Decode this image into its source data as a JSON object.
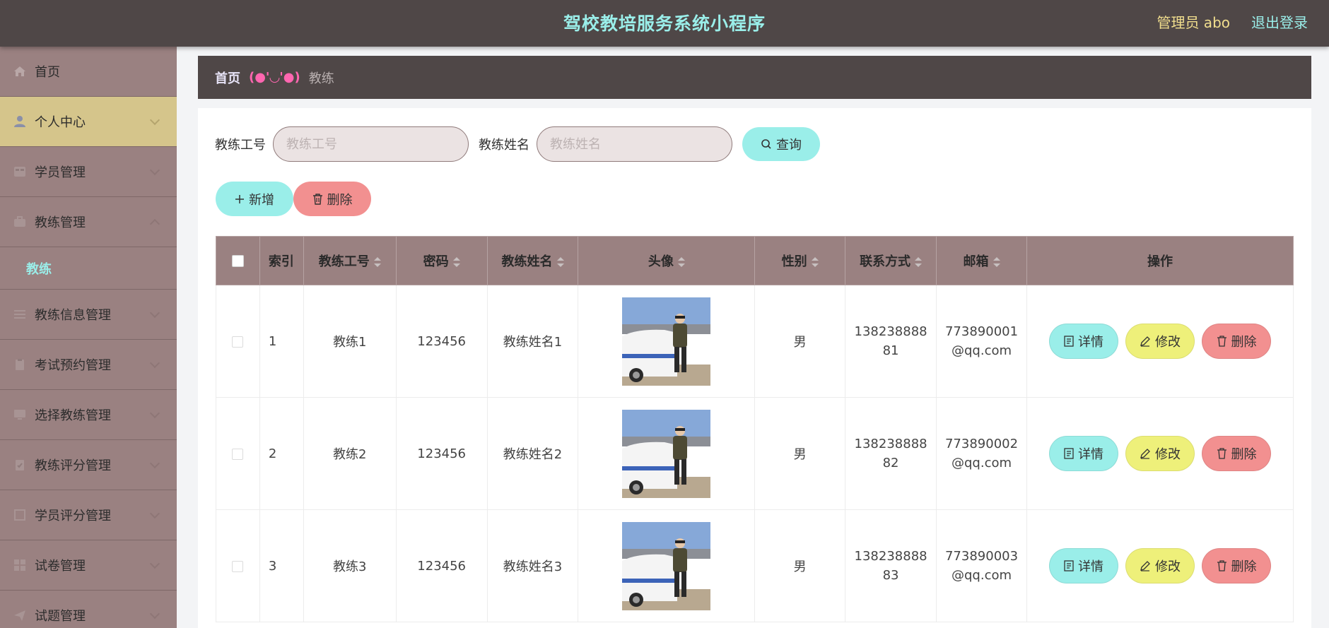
{
  "header": {
    "title": "驾校教培服务系统小程序",
    "admin": "管理员 abo",
    "logout": "退出登录"
  },
  "sidebar": {
    "items": [
      {
        "label": "首页",
        "icon": "home-icon"
      },
      {
        "label": "个人中心",
        "icon": "user-icon"
      },
      {
        "label": "学员管理",
        "icon": "grid-icon"
      },
      {
        "label": "教练管理",
        "icon": "briefcase-icon"
      },
      {
        "label": "教练",
        "icon": ""
      },
      {
        "label": "教练信息管理",
        "icon": "list-icon"
      },
      {
        "label": "考试预约管理",
        "icon": "clipboard-icon"
      },
      {
        "label": "选择教练管理",
        "icon": "monitor-icon"
      },
      {
        "label": "教练评分管理",
        "icon": "clipboard-check-icon"
      },
      {
        "label": "学员评分管理",
        "icon": "square-icon"
      },
      {
        "label": "试卷管理",
        "icon": "apps-icon"
      },
      {
        "label": "试题管理",
        "icon": "send-icon"
      }
    ]
  },
  "breadcrumb": {
    "home": "首页",
    "separator": "(●'◡'●)",
    "current": "教练"
  },
  "search": {
    "id_label": "教练工号",
    "id_placeholder": "教练工号",
    "name_label": "教练姓名",
    "name_placeholder": "教练姓名",
    "query_label": "查询"
  },
  "actions": {
    "add_label": "新增",
    "delete_label": "删除"
  },
  "table": {
    "headers": [
      "索引",
      "教练工号",
      "密码",
      "教练姓名",
      "头像",
      "性别",
      "联系方式",
      "邮箱",
      "操作"
    ],
    "rows": [
      {
        "index": "1",
        "coach_id": "教练1",
        "password": "123456",
        "name": "教练姓名1",
        "gender": "男",
        "phone_a": "138238888",
        "phone_b": "81",
        "email_a": "773890001",
        "email_b": "@qq.com"
      },
      {
        "index": "2",
        "coach_id": "教练2",
        "password": "123456",
        "name": "教练姓名2",
        "gender": "男",
        "phone_a": "138238888",
        "phone_b": "82",
        "email_a": "773890002",
        "email_b": "@qq.com"
      },
      {
        "index": "3",
        "coach_id": "教练3",
        "password": "123456",
        "name": "教练姓名3",
        "gender": "男",
        "phone_a": "138238888",
        "phone_b": "83",
        "email_a": "773890003",
        "email_b": "@qq.com"
      }
    ],
    "row_actions": {
      "detail": "详情",
      "edit": "修改",
      "delete": "删除"
    }
  },
  "colors": {
    "header_bg": "#4f4747",
    "accent_cyan": "#9aeee9",
    "accent_gold": "#f2df8e",
    "sidebar_bg": "#9a8181",
    "active_menu": "#d5c58b",
    "edit_yellow": "#eef07a",
    "delete_red": "#f29090"
  }
}
